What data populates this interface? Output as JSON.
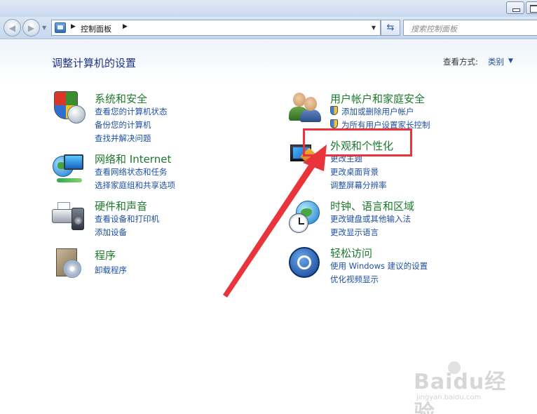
{
  "window": {
    "breadcrumb": "控制面板",
    "search_placeholder": "搜索控制面板"
  },
  "header": {
    "title": "调整计算机的设置",
    "view_label": "查看方式:",
    "view_value": "类别"
  },
  "categories": [
    {
      "title": "系统和安全",
      "links": [
        "查看您的计算机状态",
        "备份您的计算机",
        "查找并解决问题"
      ]
    },
    {
      "title": "网络和 Internet",
      "links": [
        "查看网络状态和任务",
        "选择家庭组和共享选项"
      ]
    },
    {
      "title": "硬件和声音",
      "links": [
        "查看设备和打印机",
        "添加设备"
      ]
    },
    {
      "title": "程序",
      "links": [
        "卸载程序"
      ]
    },
    {
      "title": "用户帐户和家庭安全",
      "links": [
        "添加或删除用户帐户",
        "为所有用户设置家长控制"
      ]
    },
    {
      "title": "外观和个性化",
      "links": [
        "更改主题",
        "更改桌面背景",
        "调整屏幕分辨率"
      ]
    },
    {
      "title": "时钟、语言和区域",
      "links": [
        "更改键盘或其他输入法",
        "更改显示语言"
      ]
    },
    {
      "title": "轻松访问",
      "links": [
        "使用 Windows 建议的设置",
        "优化视频显示"
      ]
    }
  ],
  "colors": {
    "category_title": "#1c7a2c",
    "link": "#1e4fa3",
    "annotation": "#e8343a"
  },
  "watermark": {
    "text": "Baidu经验",
    "url": "jingyan.baidu.com"
  }
}
